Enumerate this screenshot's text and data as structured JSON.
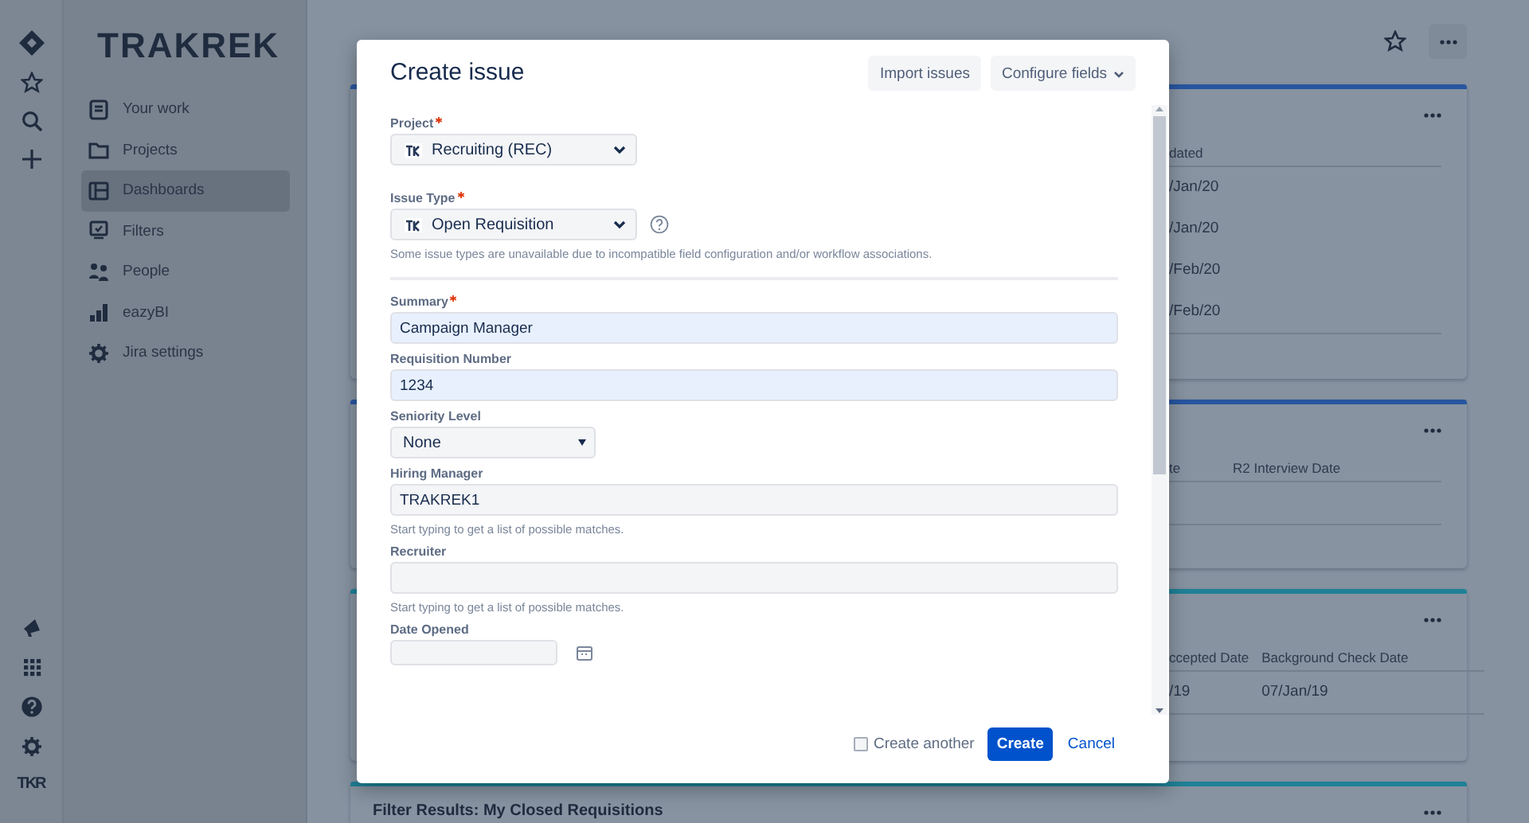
{
  "rail": {
    "logo": "TKR"
  },
  "sidebar": {
    "logo": "TRAKREK",
    "items": [
      {
        "label": "Your work",
        "selected": false
      },
      {
        "label": "Projects",
        "selected": false
      },
      {
        "label": "Dashboards",
        "selected": true
      },
      {
        "label": "Filters",
        "selected": false
      },
      {
        "label": "People",
        "selected": false
      },
      {
        "label": "eazyBI",
        "selected": false
      },
      {
        "label": "Jira settings",
        "selected": false
      }
    ]
  },
  "dashboard": {
    "cards": [
      {
        "color": "#27569f",
        "columns": [
          "dated"
        ],
        "rows": [
          [
            "/Jan/20"
          ],
          [
            "/Jan/20"
          ],
          [
            "/Feb/20"
          ],
          [
            "/Feb/20"
          ]
        ]
      },
      {
        "color": "#27569f",
        "columns": [
          "te",
          "R2 Interview Date"
        ]
      },
      {
        "color": "#1f8196",
        "columns": [
          "ccepted Date",
          "Background Check Date"
        ],
        "rows": [
          [
            "/19",
            "07/Jan/19"
          ]
        ]
      },
      {
        "color": "#1f8196",
        "title": "Filter Results: My Closed Requisitions"
      }
    ]
  },
  "dialog": {
    "title": "Create issue",
    "actions": [
      {
        "label": "Import issues",
        "caret": false
      },
      {
        "label": "Configure fields",
        "caret": true
      }
    ],
    "fields": [
      {
        "kind": "select",
        "label": "Project",
        "required": true,
        "value": "Recruiting (REC)"
      },
      {
        "kind": "select",
        "label": "Issue Type",
        "required": true,
        "value": "Open Requisition",
        "help_icon": true,
        "help": "Some issue types are unavailable due to incompatible field configuration and/or workflow associations."
      },
      {
        "kind": "divider"
      },
      {
        "kind": "text",
        "label": "Summary",
        "required": true,
        "value": "Campaign Manager",
        "autofilled": true
      },
      {
        "kind": "text",
        "label": "Requisition Number",
        "value": "1234",
        "autofilled": true
      },
      {
        "kind": "dropdown",
        "label": "Seniority Level",
        "value": "None"
      },
      {
        "kind": "text",
        "label": "Hiring Manager",
        "value": "TRAKREK1",
        "autofilled": false,
        "help": "Start typing to get a list of possible matches."
      },
      {
        "kind": "text",
        "label": "Recruiter",
        "autofilled": false,
        "help": "Start typing to get a list of possible matches."
      },
      {
        "kind": "date",
        "label": "Date Opened"
      }
    ],
    "footer": {
      "create_another": {
        "label": "Create another",
        "checked": false
      },
      "submit": "Create",
      "cancel": "Cancel"
    }
  }
}
